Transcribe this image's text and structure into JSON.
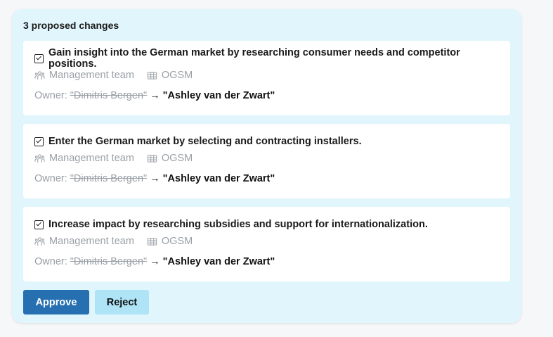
{
  "panel": {
    "title": "3 proposed changes"
  },
  "changes": [
    {
      "title": "Gain insight into the German market by researching consumer needs and competitor positions.",
      "team": "Management team",
      "board": "OGSM",
      "owner_label": "Owner:",
      "old_value": "\"Dimitris Bergen\"",
      "arrow": "→",
      "new_value": "\"Ashley van der Zwart\""
    },
    {
      "title": "Enter the German market by selecting and contracting installers.",
      "team": "Management team",
      "board": "OGSM",
      "owner_label": "Owner:",
      "old_value": "\"Dimitris Bergen\"",
      "arrow": "→",
      "new_value": "\"Ashley van der Zwart\""
    },
    {
      "title": "Increase impact by researching subsidies and support for internationalization.",
      "team": "Management team",
      "board": "OGSM",
      "owner_label": "Owner:",
      "old_value": "\"Dimitris Bergen\"",
      "arrow": "→",
      "new_value": "\"Ashley van der Zwart\""
    }
  ],
  "actions": {
    "approve_label": "Approve",
    "reject_label": "Reject"
  },
  "colors": {
    "panel_bg": "#e1f5fc",
    "approve_bg": "#2670b2",
    "reject_bg": "#aee4f6",
    "muted_text": "#9aa0a6"
  },
  "icons": {
    "checkbox": "checkbox-checked-icon",
    "team": "team-icon",
    "board": "table-icon"
  }
}
